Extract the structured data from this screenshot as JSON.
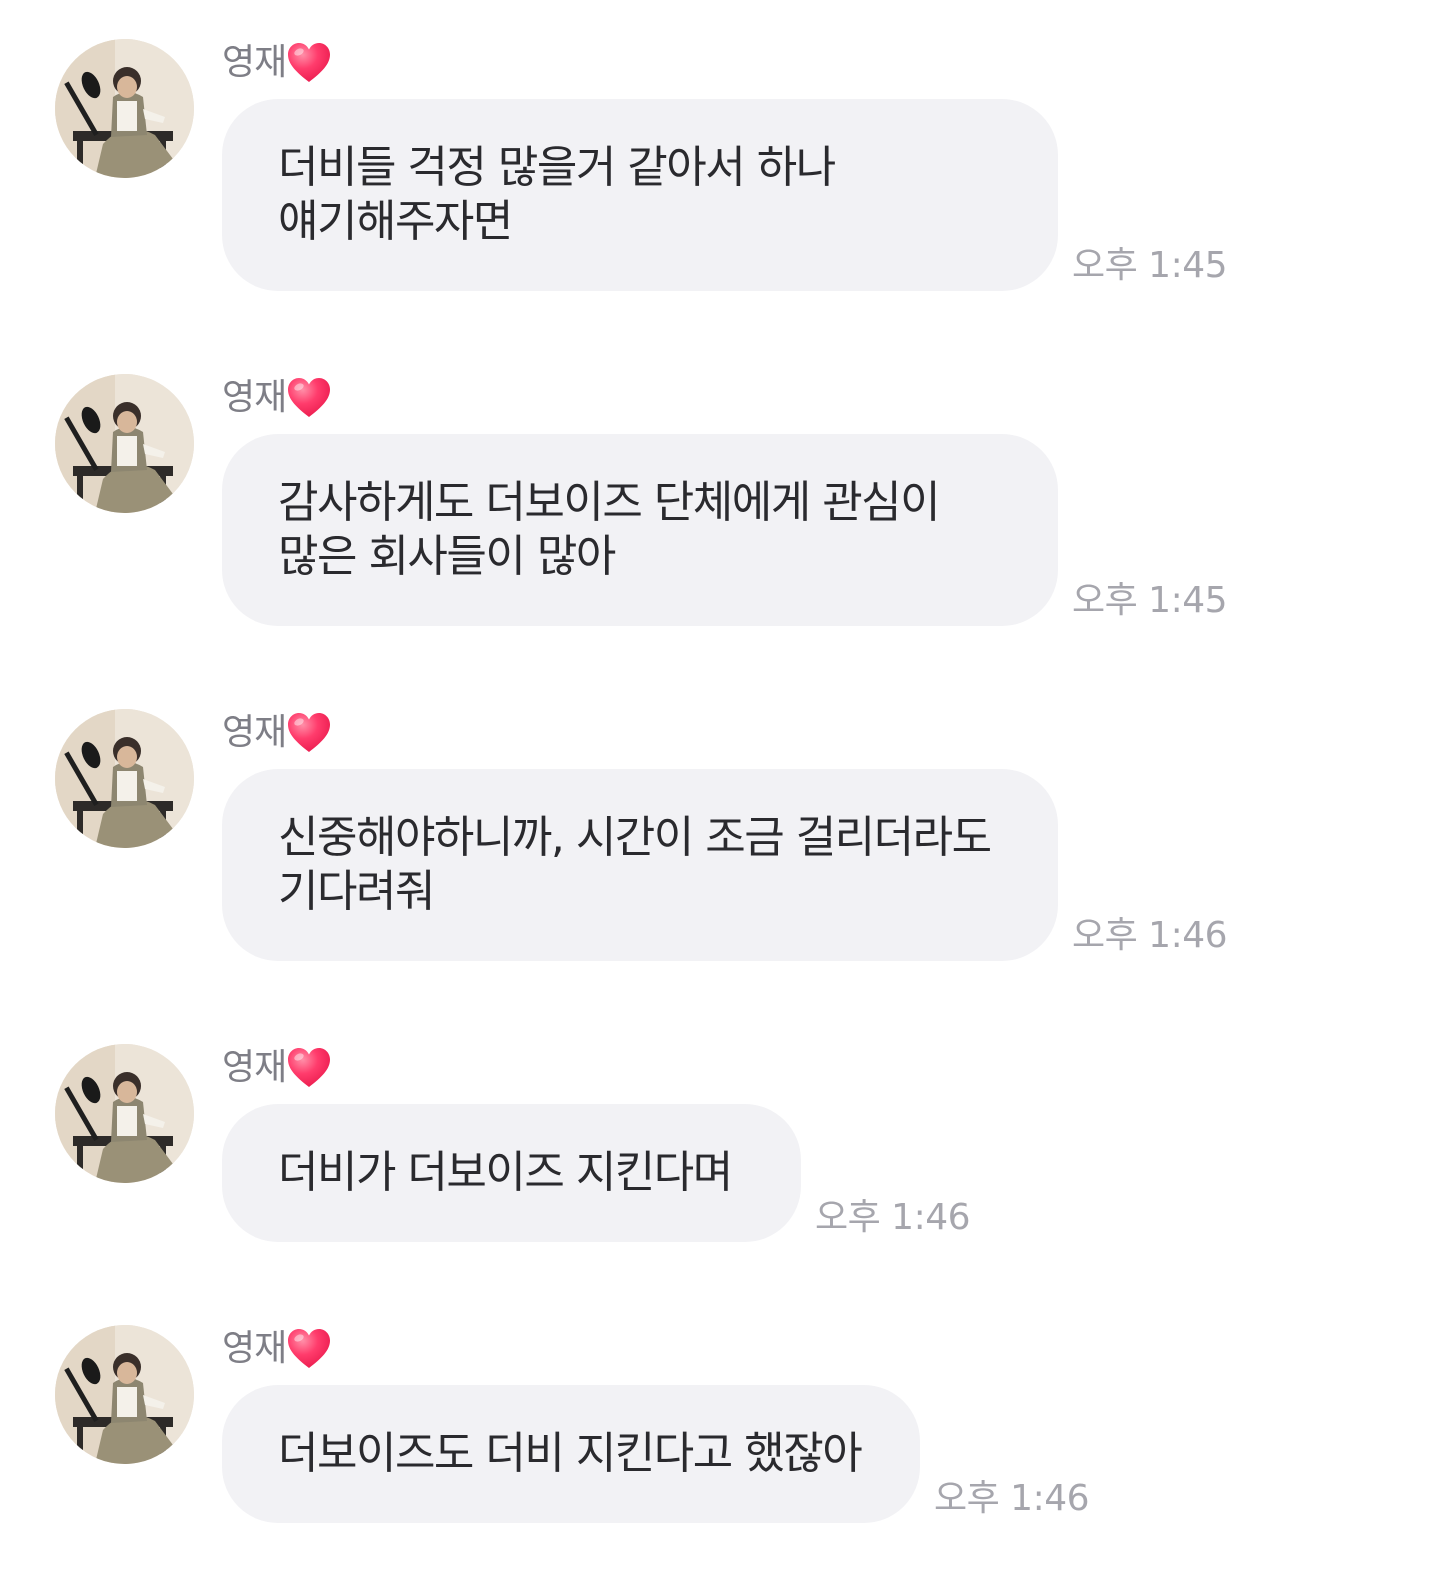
{
  "sender": {
    "name": "영재",
    "heart_icon": "heart-icon",
    "avatar_icon": "profile-photo-avatar"
  },
  "colors": {
    "bubble": "#f2f2f5",
    "text": "#2a2a2e",
    "name": "#7e7e86",
    "time": "#a6a6ad",
    "heart": "#ff2e63"
  },
  "messages": [
    {
      "text": "더비들 걱정 많을거 같아서 하나\n얘기해주자면",
      "time": "오후 1:45"
    },
    {
      "text": "감사하게도 더보이즈 단체에게 관심이\n많은 회사들이 많아",
      "time": "오후 1:45"
    },
    {
      "text": "신중해야하니까, 시간이 조금 걸리더라도\n기다려줘",
      "time": "오후 1:46"
    },
    {
      "text": "더비가 더보이즈 지킨다며",
      "time": "오후 1:46"
    },
    {
      "text": "더보이즈도 더비 지킨다고 했잖아",
      "time": "오후 1:46"
    }
  ]
}
